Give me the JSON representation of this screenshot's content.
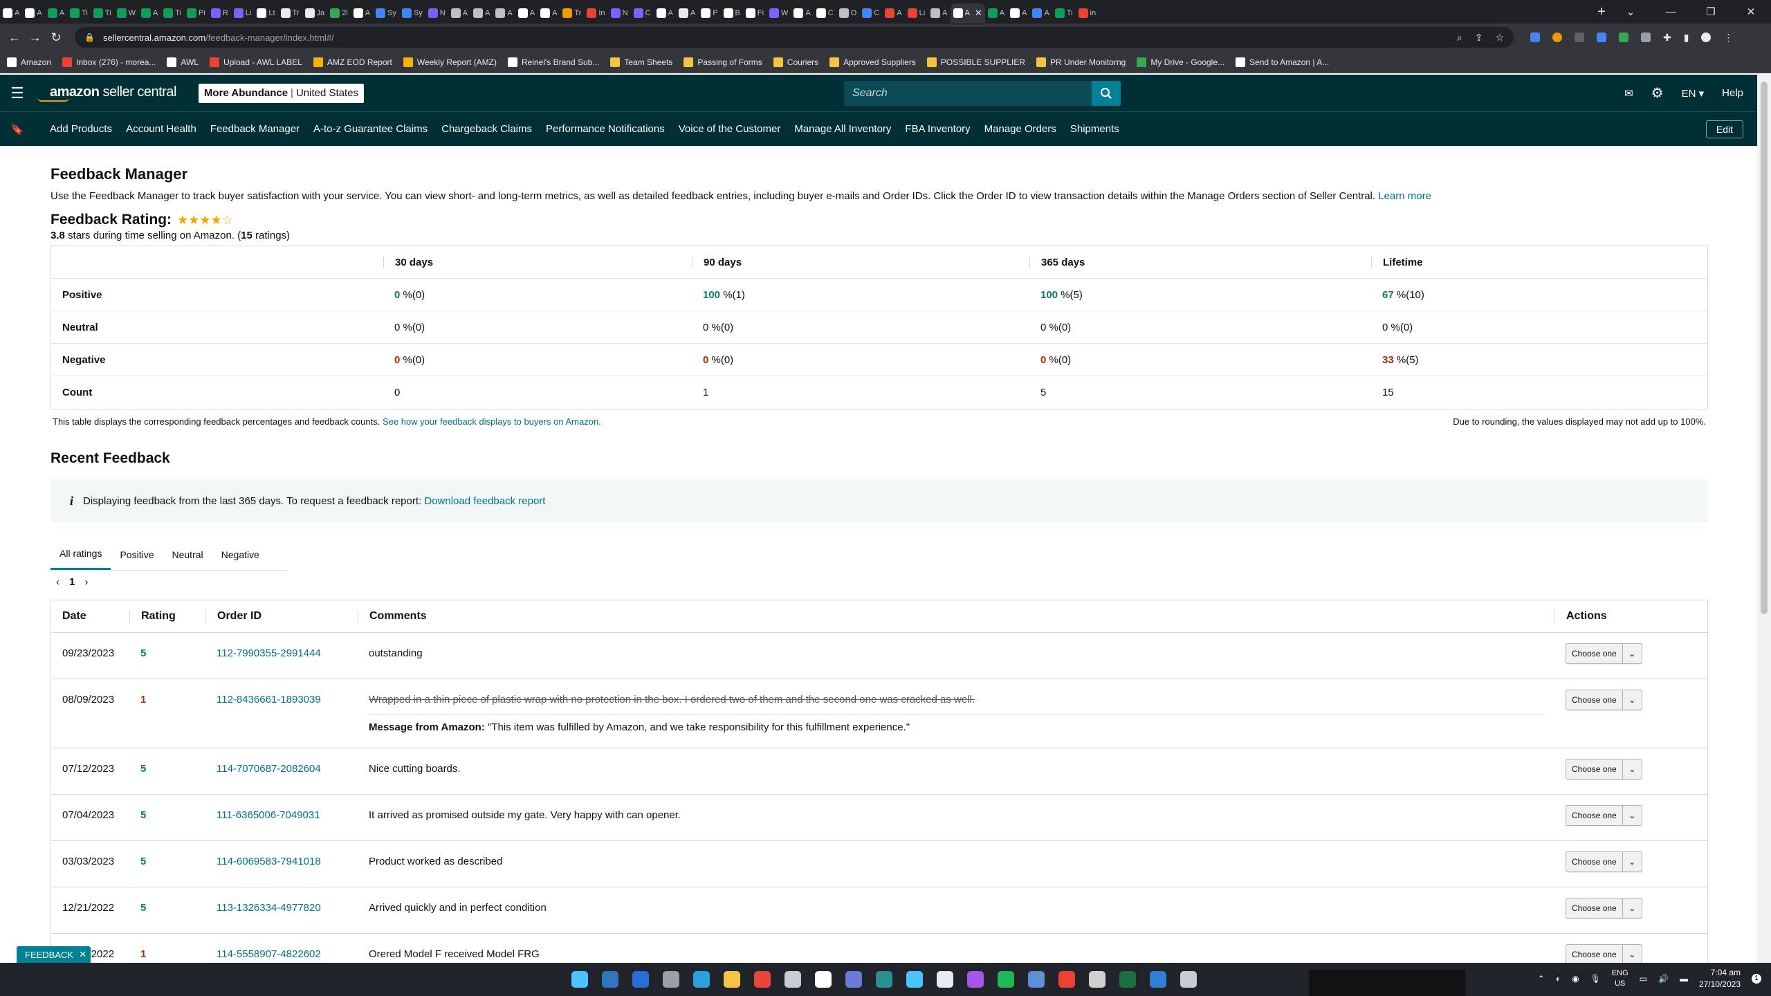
{
  "browser": {
    "tabs": [
      {
        "label": "A",
        "color": "#ffffff",
        "active": false
      },
      {
        "label": "A",
        "color": "#ffffff",
        "active": false
      },
      {
        "label": "A",
        "color": "#0f9d58",
        "active": false
      },
      {
        "label": "Ti",
        "color": "#0f9d58",
        "active": false
      },
      {
        "label": "Ti",
        "color": "#0f9d58",
        "active": false
      },
      {
        "label": "W",
        "color": "#0f9d58",
        "active": false
      },
      {
        "label": "A",
        "color": "#0f9d58",
        "active": false
      },
      {
        "label": "Ti",
        "color": "#0f9d58",
        "active": false
      },
      {
        "label": "Pi",
        "color": "#0f9d58",
        "active": false
      },
      {
        "label": "R",
        "color": "#7b61ff",
        "active": false
      },
      {
        "label": "Li",
        "color": "#7b61ff",
        "active": false
      },
      {
        "label": "Lt",
        "color": "#ffffff",
        "active": false
      },
      {
        "label": "Tr",
        "color": "#e8eaed",
        "active": false
      },
      {
        "label": "Ja",
        "color": "#e8eaed",
        "active": false
      },
      {
        "label": "2l",
        "color": "#34a853",
        "active": false
      },
      {
        "label": "A",
        "color": "#ffffff",
        "active": false
      },
      {
        "label": "Sy",
        "color": "#4285f4",
        "active": false
      },
      {
        "label": "Sy",
        "color": "#4285f4",
        "active": false
      },
      {
        "label": "N",
        "color": "#7b61ff",
        "active": false
      },
      {
        "label": "A",
        "color": "#bdc1c6",
        "active": false
      },
      {
        "label": "A",
        "color": "#bdc1c6",
        "active": false
      },
      {
        "label": "A",
        "color": "#bdc1c6",
        "active": false
      },
      {
        "label": "A",
        "color": "#ffffff",
        "active": false
      },
      {
        "label": "A",
        "color": "#ffffff",
        "active": false
      },
      {
        "label": "Tr",
        "color": "#f29900",
        "active": false
      },
      {
        "label": "In",
        "color": "#ea4335",
        "active": false
      },
      {
        "label": "N",
        "color": "#7b61ff",
        "active": false
      },
      {
        "label": "C",
        "color": "#7b61ff",
        "active": false
      },
      {
        "label": "A",
        "color": "#ffffff",
        "active": false
      },
      {
        "label": "A",
        "color": "#e8eaed",
        "active": false
      },
      {
        "label": "P",
        "color": "#ffffff",
        "active": false
      },
      {
        "label": "B",
        "color": "#ffffff",
        "active": false
      },
      {
        "label": "Fi",
        "color": "#ffffff",
        "active": false
      },
      {
        "label": "W",
        "color": "#7b61ff",
        "active": false
      },
      {
        "label": "A",
        "color": "#ffffff",
        "active": false
      },
      {
        "label": "C",
        "color": "#ffffff",
        "active": false
      },
      {
        "label": "O",
        "color": "#bdc1c6",
        "active": false
      },
      {
        "label": "C",
        "color": "#4285f4",
        "active": false
      },
      {
        "label": "A",
        "color": "#ea4335",
        "active": false
      },
      {
        "label": "Li",
        "color": "#ea4335",
        "active": false
      },
      {
        "label": "A",
        "color": "#bdc1c6",
        "active": false
      },
      {
        "label": "A",
        "color": "#ffffff",
        "active": true
      },
      {
        "label": "A",
        "color": "#0f9d58",
        "active": false
      },
      {
        "label": "A",
        "color": "#ffffff",
        "active": false
      },
      {
        "label": "A",
        "color": "#4285f4",
        "active": false
      },
      {
        "label": "Ti",
        "color": "#0f9d58",
        "active": false
      },
      {
        "label": "in",
        "color": "#ea4335",
        "active": false
      }
    ],
    "url_host": "sellercentral.amazon.com",
    "url_path": "/feedback-manager/index.html#/",
    "bookmarks": [
      {
        "label": "Amazon",
        "color": "#ffffff"
      },
      {
        "label": "Inbox (276) - morea...",
        "color": "#ea4335"
      },
      {
        "label": "AWL",
        "color": "#ffffff"
      },
      {
        "label": "Upload - AWL LABEL",
        "color": "#ea4335"
      },
      {
        "label": "AMZ EOD Report",
        "color": "#f4b400"
      },
      {
        "label": "Weekly Report (AMZ)",
        "color": "#f4b400"
      },
      {
        "label": "Reinel's Brand Sub...",
        "color": "#ffffff"
      },
      {
        "label": "Team Sheets",
        "color": "#f4c542"
      },
      {
        "label": "Passing of Forms",
        "color": "#f4c542"
      },
      {
        "label": "Couriers",
        "color": "#f4c542"
      },
      {
        "label": "Approved Suppliers",
        "color": "#f4c542"
      },
      {
        "label": "POSSIBLE SUPPLIER",
        "color": "#f4c542"
      },
      {
        "label": "PR Under Monitorng",
        "color": "#f4c542"
      },
      {
        "label": "My Drive - Google...",
        "color": "#34a853"
      },
      {
        "label": "Send to Amazon | A...",
        "color": "#ffffff"
      }
    ]
  },
  "header": {
    "logo_brand": "amazon",
    "logo_product": "seller central",
    "store_name": "More Abundance",
    "store_region": "United States",
    "search_placeholder": "Search",
    "language": "EN",
    "help": "Help",
    "nav": [
      "Add Products",
      "Account Health",
      "Feedback Manager",
      "A-to-z Guarantee Claims",
      "Chargeback Claims",
      "Performance Notifications",
      "Voice of the Customer",
      "Manage All Inventory",
      "FBA Inventory",
      "Manage Orders",
      "Shipments"
    ],
    "edit": "Edit"
  },
  "page": {
    "title": "Feedback Manager",
    "description": "Use the Feedback Manager to track buyer satisfaction with your service. You can view short- and long-term metrics, as well as detailed feedback entries, including buyer e-mails and Order IDs. Click the Order ID to view transaction details within the Manage Orders section of Seller Central.",
    "learn_more": "Learn more",
    "rating_label": "Feedback Rating:",
    "stars_value": 3.8,
    "stars_glyphs": "★★★★☆",
    "rating_avg": "3.8",
    "rating_mid": " stars during time selling on Amazon. (",
    "rating_count": "15",
    "rating_end": " ratings)"
  },
  "summary": {
    "headers": [
      "30 days",
      "90 days",
      "365 days",
      "Lifetime"
    ],
    "rows": [
      {
        "label": "Positive",
        "kind": "pos",
        "values": [
          [
            "0",
            " %(0)"
          ],
          [
            "100",
            " %(1)"
          ],
          [
            "100",
            " %(5)"
          ],
          [
            "67",
            " %(10)"
          ]
        ]
      },
      {
        "label": "Neutral",
        "kind": "neu",
        "values": [
          [
            "0",
            " %(0)"
          ],
          [
            "0",
            " %(0)"
          ],
          [
            "0",
            " %(0)"
          ],
          [
            "0",
            " %(0)"
          ]
        ]
      },
      {
        "label": "Negative",
        "kind": "neg",
        "values": [
          [
            "0",
            " %(0)"
          ],
          [
            "0",
            " %(0)"
          ],
          [
            "0",
            " %(0)"
          ],
          [
            "33",
            " %(5)"
          ]
        ]
      },
      {
        "label": "Count",
        "kind": "cnt",
        "values": [
          [
            "0",
            ""
          ],
          [
            "1",
            ""
          ],
          [
            "5",
            ""
          ],
          [
            "15",
            ""
          ]
        ]
      }
    ],
    "note_left": "This table displays the corresponding feedback percentages and feedback counts.",
    "note_link": "See how your feedback displays to buyers on Amazon.",
    "note_right": "Due to rounding, the values displayed may not add up to 100%."
  },
  "recent": {
    "title": "Recent Feedback",
    "info_text": "Displaying feedback from the last 365 days. To request a feedback report:",
    "info_link": "Download feedback report",
    "tabs": [
      "All ratings",
      "Positive",
      "Neutral",
      "Negative"
    ],
    "active_tab": 0,
    "page": "1",
    "columns": [
      "Date",
      "Rating",
      "Order ID",
      "Comments",
      "Actions"
    ],
    "action_label": "Choose one",
    "rows": [
      {
        "date": "09/23/2023",
        "rating": "5",
        "order": "112-7990355-2991444",
        "comment": "outstanding",
        "struck": false,
        "msg_label": "",
        "msg": ""
      },
      {
        "date": "08/09/2023",
        "rating": "1",
        "order": "112-8436661-1893039",
        "comment": "Wrapped in a thin piece of plastic wrap with no protection in the box. I ordered two of them and the second one was cracked as well.",
        "struck": true,
        "msg_label": "Message from Amazon:",
        "msg": " \"This item was fulfilled by Amazon, and we take responsibility for this fulfillment experience.\""
      },
      {
        "date": "07/12/2023",
        "rating": "5",
        "order": "114-7070687-2082604",
        "comment": "Nice cutting boards.",
        "struck": false,
        "msg_label": "",
        "msg": ""
      },
      {
        "date": "07/04/2023",
        "rating": "5",
        "order": "111-6365006-7049031",
        "comment": "It arrived as promised outside my gate. Very happy with can opener.",
        "struck": false,
        "msg_label": "",
        "msg": ""
      },
      {
        "date": "03/03/2023",
        "rating": "5",
        "order": "114-6069583-7941018",
        "comment": "Product worked as described",
        "struck": false,
        "msg_label": "",
        "msg": ""
      },
      {
        "date": "12/21/2022",
        "rating": "5",
        "order": "113-1326334-4977820",
        "comment": "Arrived quickly and in perfect condition",
        "struck": false,
        "msg_label": "",
        "msg": ""
      },
      {
        "date": "12/17/2022",
        "rating": "1",
        "order": "114-5558907-4822602",
        "comment": "Orered Model F received Model FRG",
        "struck": false,
        "msg_label": "",
        "msg": ""
      }
    ]
  },
  "feedback_pill": "FEEDBACK",
  "taskbar": {
    "icons": [
      "#4cc2ff",
      "#3277bc",
      "#2b6cd6",
      "#9aa0a6",
      "#2aa1de",
      "#f4c542",
      "#e8453c",
      "#c9cdd1",
      "#ffffff",
      "#6a7bd8",
      "#2c8f8f",
      "#4cc2ff",
      "#e8eaed",
      "#a257e6",
      "#1db954",
      "#5f8fd8",
      "#ea4335",
      "#d0d0d0",
      "#1d6f42",
      "#2f7fd6",
      "#c9cdd1"
    ],
    "lang_top": "ENG",
    "lang_bottom": "US",
    "time": "7:04 am",
    "date": "27/10/2023"
  }
}
